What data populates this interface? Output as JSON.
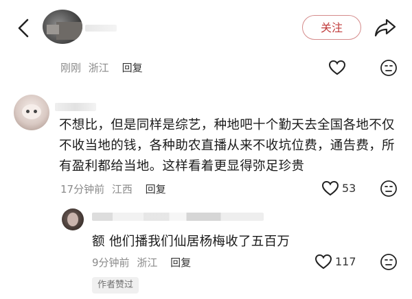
{
  "header": {
    "follow_label": "关注"
  },
  "post_meta": {
    "time": "刚刚",
    "location": "浙江",
    "reply_label": "回复"
  },
  "comment1": {
    "text": "不想比，但是同样是综艺，种地吧十个勤天去全国各地不仅不收当地的钱，各种助农直播从来不收坑位费，通告费，所有盈利都给当地。这样看着更显得弥足珍贵",
    "time": "17分钟前",
    "location": "江西",
    "reply_label": "回复",
    "like_count": "53"
  },
  "reply1": {
    "text": "额 他们播我们仙居杨梅收了五百万",
    "time": "9分钟前",
    "location": "浙江",
    "reply_label": "回复",
    "like_count": "117",
    "author_liked_label": "作者赞过"
  },
  "icons": {
    "back": "chevron-left-icon",
    "share": "share-arrow-icon",
    "like": "heart-outline-icon",
    "dislike": "frown-face-icon"
  },
  "colors": {
    "follow_accent": "#c03a3a",
    "meta_gray": "#8a8a8a"
  }
}
